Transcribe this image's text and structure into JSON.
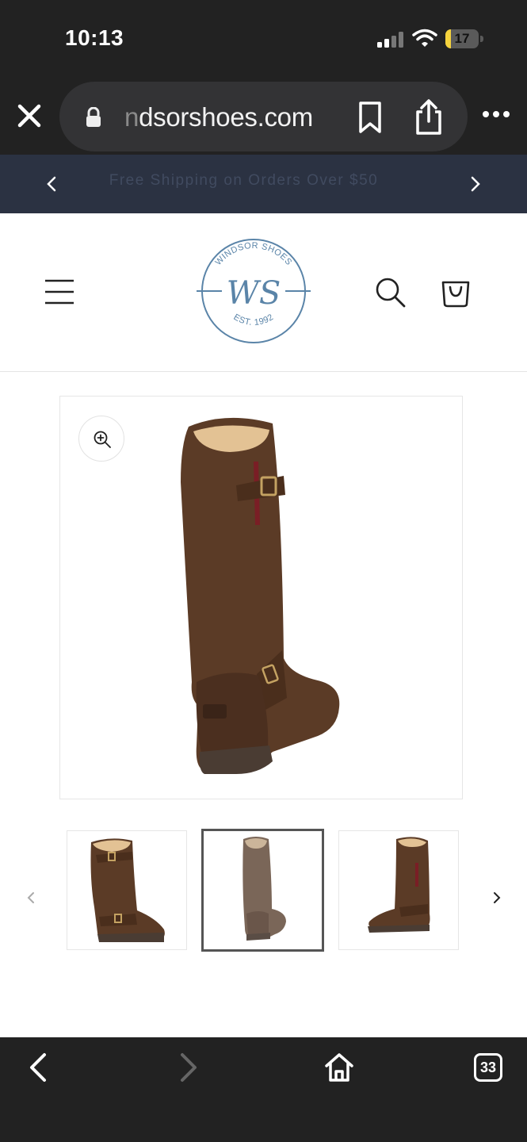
{
  "status_bar": {
    "time": "10:13",
    "battery_level": "17",
    "battery_fraction": 0.17,
    "icons": [
      "signal-icon",
      "wifi-icon",
      "battery-icon"
    ]
  },
  "browser": {
    "url_faded": "n",
    "url_text": "dsorshoes.com",
    "icons": [
      "close-icon",
      "lock-icon",
      "bookmark-icon",
      "share-icon",
      "more-icon"
    ]
  },
  "announcement": {
    "text": "Free Shipping on Orders Over $50",
    "icons": [
      "chevron-left-icon",
      "chevron-right-icon"
    ]
  },
  "header": {
    "logo_top": "WINDSOR SHOES",
    "logo_monogram": "WS",
    "logo_bottom": "EST. 1992",
    "icons": [
      "menu-icon",
      "search-icon",
      "cart-icon"
    ]
  },
  "product": {
    "thumbnails": [
      "boot-front-thumbnail",
      "boot-back-thumbnail",
      "boot-side-thumbnail"
    ],
    "active_thumbnail": 1,
    "icons": [
      "zoom-icon",
      "chevron-left-icon",
      "chevron-right-icon"
    ]
  },
  "bottom_toolbar": {
    "tab_count": "33",
    "icons": [
      "back-icon",
      "forward-icon",
      "home-icon",
      "tabs-icon"
    ]
  },
  "colors": {
    "browser_chrome": "#222222",
    "announcement_bg": "#2b3242",
    "logo_blue": "#5a84a8",
    "boot_brown": "#5b3b26",
    "battery_yellow": "#f5d33d"
  }
}
